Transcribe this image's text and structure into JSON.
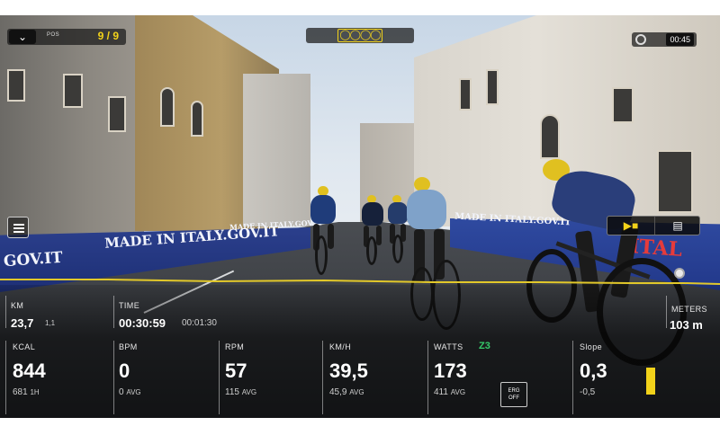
{
  "colors": {
    "accent": "#f2d21a",
    "zone": "#35c96a",
    "route": "#e2c82a"
  },
  "header": {
    "pos_label": "POS",
    "pos_value": "9 / 9",
    "clock_time": "00:45",
    "riders_icon": "bike-group-icon"
  },
  "scene": {
    "banner_left_1": "MADE IN ITALY.GOV.IT",
    "banner_left_2": "MADE IN ITALY.GOV.IT",
    "banner_left_3": "GOV.IT",
    "banner_right_1": "MADE IN ITALY.GOV.IT",
    "banner_right_2": "ITAL"
  },
  "controls": {
    "camera_icon": "camera-icon",
    "map_icon": "map-icon",
    "menu_icon": "menu-icon"
  },
  "stats": {
    "km": {
      "label": "KM",
      "value": "23,7",
      "sub": "1,1"
    },
    "time": {
      "label": "TIME",
      "value": "00:30:59",
      "sub": "00:01:30"
    },
    "meters": {
      "label": "METERS",
      "value": "103 m"
    },
    "kcal": {
      "label": "KCAL",
      "value": "844",
      "sub": "681",
      "sub_unit": "1H"
    },
    "bpm": {
      "label": "BPM",
      "value": "0",
      "sub": "0",
      "sub_unit": "AVG"
    },
    "rpm": {
      "label": "RPM",
      "value": "57",
      "sub": "115",
      "sub_unit": "AVG"
    },
    "kmh": {
      "label": "KM/H",
      "value": "39,5",
      "sub": "45,9",
      "sub_unit": "AVG"
    },
    "watts": {
      "label": "WATTS",
      "zone": "Z3",
      "value": "173",
      "sub": "411",
      "sub_unit": "AVG",
      "erg_line1": "ERG",
      "erg_line2": "OFF"
    },
    "slope": {
      "label": "Slope",
      "value": "0,3",
      "sub": "-0,5"
    }
  }
}
